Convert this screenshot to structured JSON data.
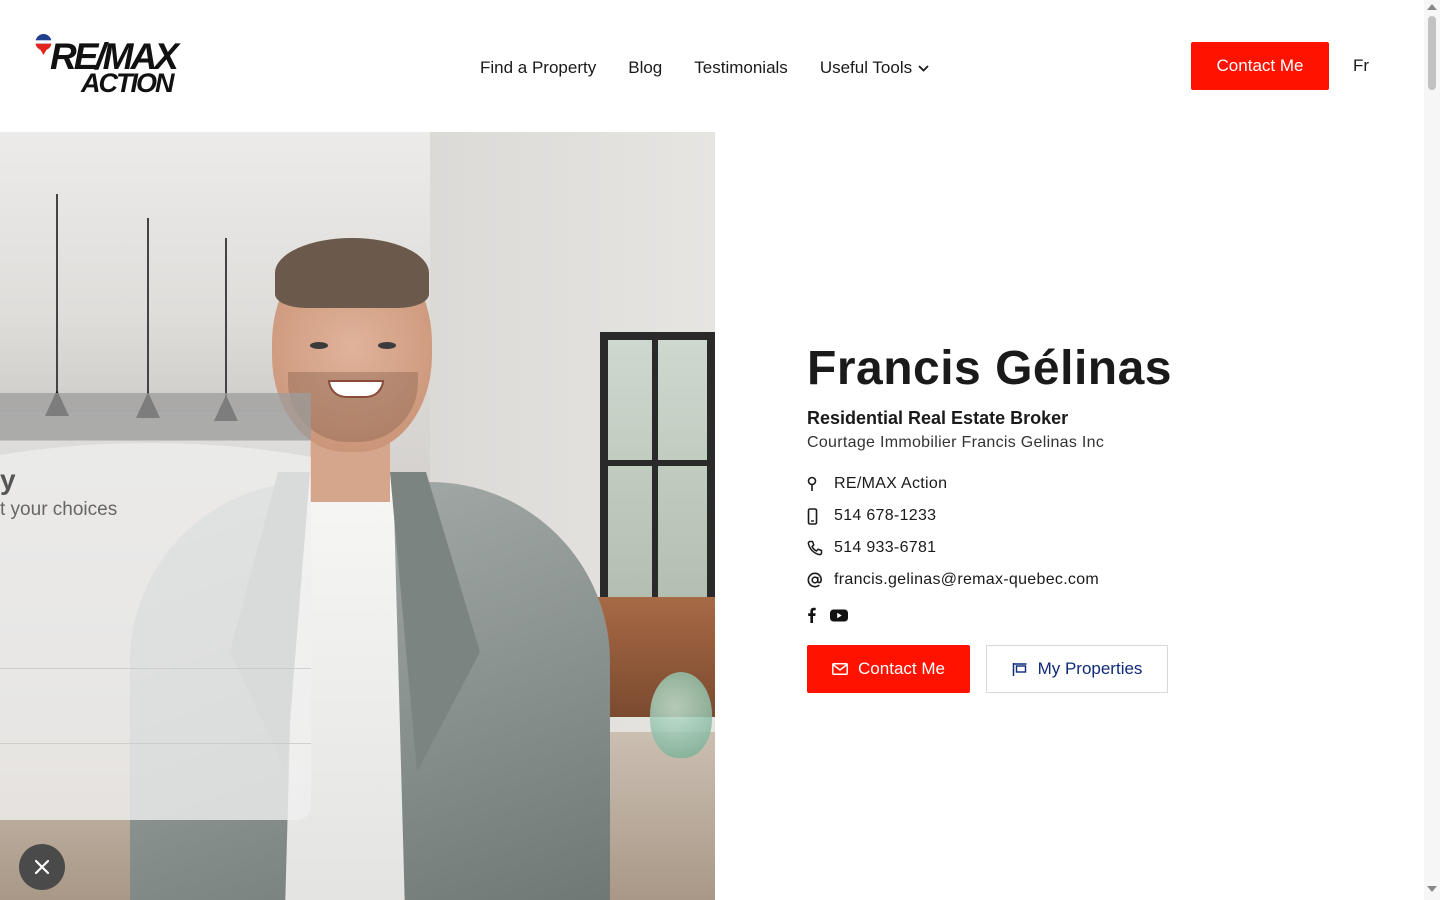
{
  "brand": {
    "logo_line1": "RE/MAX",
    "logo_line2": "ACTION",
    "accent_color": "#ff1200",
    "link_blue": "#0f2a78"
  },
  "nav": {
    "items": [
      {
        "label": "Find a Property"
      },
      {
        "label": "Blog"
      },
      {
        "label": "Testimonials"
      },
      {
        "label": "Useful Tools"
      }
    ],
    "contact_label": "Contact Me",
    "language_label": "Fr"
  },
  "overlay": {
    "title_fragment": "y",
    "subtitle_fragment": "t your choices"
  },
  "profile": {
    "name": "Francis Gélinas",
    "role": "Residential Real Estate Broker",
    "company": "Courtage Immobilier Francis Gelinas Inc",
    "office": "RE/MAX Action",
    "mobile": "514 678-1233",
    "phone": "514 933-6781",
    "email": "francis.gelinas@remax-quebec.com",
    "social": [
      "facebook-icon",
      "youtube-icon"
    ],
    "buttons": {
      "contact_label": "Contact Me",
      "properties_label": "My Properties"
    }
  }
}
